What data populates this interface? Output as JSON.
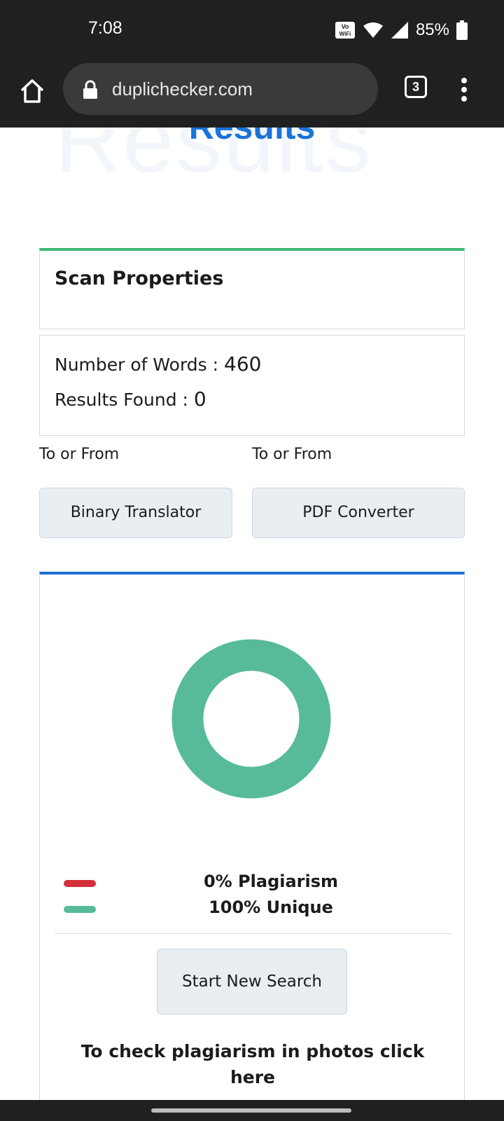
{
  "status_bar": {
    "time": "7:08",
    "battery": "85%",
    "icons": [
      "vowifi-icon",
      "wifi-icon",
      "signal-icon",
      "battery-icon"
    ]
  },
  "browser": {
    "url": "duplichecker.com",
    "tab_count": "3",
    "icons": [
      "home-icon",
      "lock-icon",
      "more-vert-icon"
    ]
  },
  "hero": {
    "title": "Results",
    "watermark": "Results"
  },
  "scan_properties": {
    "title": "Scan Properties",
    "words_label": "Number of Words : ",
    "words_value": "460",
    "results_label": "Results Found : ",
    "results_value": "0"
  },
  "tools": [
    {
      "caption": "To or From",
      "button": "Binary Translator"
    },
    {
      "caption": "To or From",
      "button": "PDF Converter"
    }
  ],
  "report": {
    "legend": [
      {
        "label": "0% Plagiarism",
        "color": "#d3303a"
      },
      {
        "label": "100% Unique",
        "color": "#57bb9b"
      }
    ],
    "new_search_label": "Start New Search",
    "photo_link": "To check plagiarism in photos click here"
  },
  "chart_data": {
    "type": "pie",
    "categories": [
      "Plagiarism",
      "Unique"
    ],
    "values": [
      0,
      100
    ],
    "colors": [
      "#d3303a",
      "#57bb9b"
    ],
    "title": ""
  },
  "colors": {
    "accent_green": "#3db875",
    "accent_blue": "#1a6fd3",
    "button_bg": "#e9eef3"
  }
}
